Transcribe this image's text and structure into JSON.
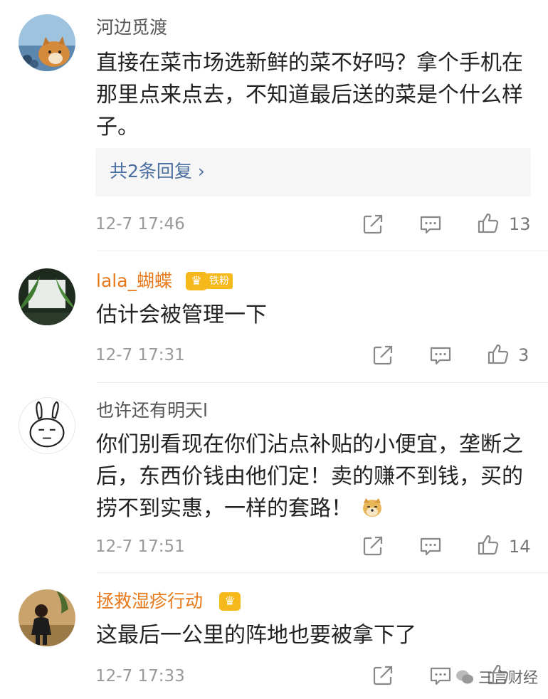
{
  "comments": [
    {
      "username": "河边觅渡",
      "text": "直接在菜市场选新鲜的菜不好吗？拿个手机在那里点来点去，不知道最后送的菜是个什么样子。",
      "replies_label": "共2条回复",
      "time": "12-7 17:46",
      "likes": "13"
    },
    {
      "username": "lala_蝴蝶",
      "badge": "铁粉",
      "text": "估计会被管理一下",
      "time": "12-7 17:31",
      "likes": "3"
    },
    {
      "username": "也许还有明天l",
      "text": "你们别看现在你们沾点补贴的小便宜，垄断之后，东西价钱由他们定！卖的赚不到钱，买的捞不到实惠，一样的套路！",
      "time": "12-7 17:51",
      "likes": "14"
    },
    {
      "username": "拯救湿疹行动",
      "text": "这最后一公里的阵地也要被拿下了",
      "time": "12-7 17:33",
      "likes": ""
    }
  ],
  "watermark": "三言财经",
  "colors": {
    "vip_name": "#e8791a",
    "link": "#4a6ea0",
    "badge": "#f6b91c"
  }
}
